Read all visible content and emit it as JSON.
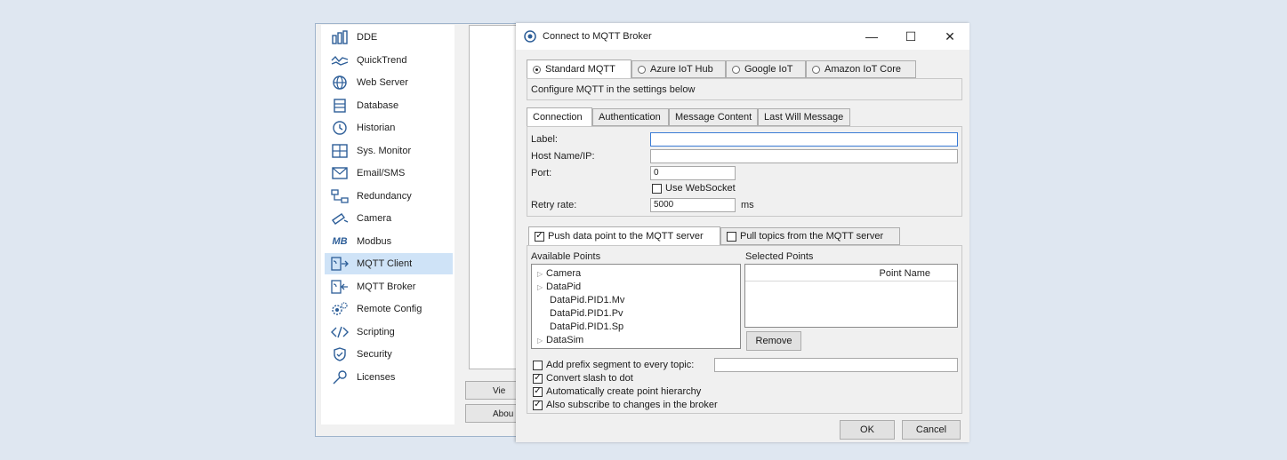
{
  "sidebar": {
    "items": [
      {
        "label": "DDE",
        "icon": "dde-icon"
      },
      {
        "label": "QuickTrend",
        "icon": "trend-icon"
      },
      {
        "label": "Web Server",
        "icon": "globe-icon"
      },
      {
        "label": "Database",
        "icon": "database-icon"
      },
      {
        "label": "Historian",
        "icon": "clock-icon"
      },
      {
        "label": "Sys. Monitor",
        "icon": "monitor-icon"
      },
      {
        "label": "Email/SMS",
        "icon": "mail-icon"
      },
      {
        "label": "Redundancy",
        "icon": "redundancy-icon"
      },
      {
        "label": "Camera",
        "icon": "camera-icon"
      },
      {
        "label": "Modbus",
        "icon": "modbus-icon"
      },
      {
        "label": "MQTT Client",
        "icon": "mqtt-client-icon",
        "selected": true
      },
      {
        "label": "MQTT Broker",
        "icon": "mqtt-broker-icon"
      },
      {
        "label": "Remote Config",
        "icon": "remote-config-icon"
      },
      {
        "label": "Scripting",
        "icon": "code-icon"
      },
      {
        "label": "Security",
        "icon": "shield-icon"
      },
      {
        "label": "Licenses",
        "icon": "key-icon"
      }
    ],
    "modbus_glyph": "MB"
  },
  "bg_buttons": {
    "view": "Vie",
    "about": "Abou"
  },
  "dialog": {
    "title": "Connect to MQTT Broker",
    "window_controls": {
      "minimize": "—",
      "maximize": "☐",
      "close": "✕"
    },
    "provider_tabs": [
      {
        "label": "Standard MQTT",
        "selected": true
      },
      {
        "label": "Azure IoT Hub",
        "selected": false
      },
      {
        "label": "Google IoT",
        "selected": false
      },
      {
        "label": "Amazon IoT Core",
        "selected": false
      }
    ],
    "info_text": "Configure MQTT in the settings below",
    "settings_tabs": [
      "Connection",
      "Authentication",
      "Message Content",
      "Last Will Message"
    ],
    "connection": {
      "label_label": "Label:",
      "label_value": "",
      "host_label": "Host Name/IP:",
      "host_value": "",
      "port_label": "Port:",
      "port_value": "0",
      "use_websocket_label": "Use WebSocket",
      "use_websocket_checked": false,
      "retry_label": "Retry rate:",
      "retry_value": "5000",
      "retry_unit": "ms"
    },
    "data_tabs": {
      "push_label": "Push data point to the MQTT server",
      "push_checked": true,
      "pull_label": "Pull topics from the MQTT server",
      "pull_checked": false
    },
    "available_points": {
      "header": "Available Points",
      "items": [
        {
          "label": "Camera",
          "expandable": true
        },
        {
          "label": "DataPid",
          "expandable": true
        },
        {
          "label": "DataPid.PID1.Mv",
          "expandable": false
        },
        {
          "label": "DataPid.PID1.Pv",
          "expandable": false
        },
        {
          "label": "DataPid.PID1.Sp",
          "expandable": false
        },
        {
          "label": "DataSim",
          "expandable": true
        }
      ]
    },
    "selected_points": {
      "header": "Selected Points",
      "column": "Point Name",
      "remove_label": "Remove"
    },
    "options": {
      "prefix_label": "Add prefix segment to every topic:",
      "prefix_value": "",
      "prefix_checked": false,
      "convert_slash_label": "Convert slash to dot",
      "convert_slash_checked": true,
      "hierarchy_label": "Automatically create point hierarchy",
      "hierarchy_checked": true,
      "subscribe_label": "Also subscribe to changes in the broker",
      "subscribe_checked": true
    },
    "ok_label": "OK",
    "cancel_label": "Cancel"
  },
  "colors": {
    "accent": "#2d5e98",
    "selection": "#cfe3f7",
    "background": "#dfe7f1"
  }
}
